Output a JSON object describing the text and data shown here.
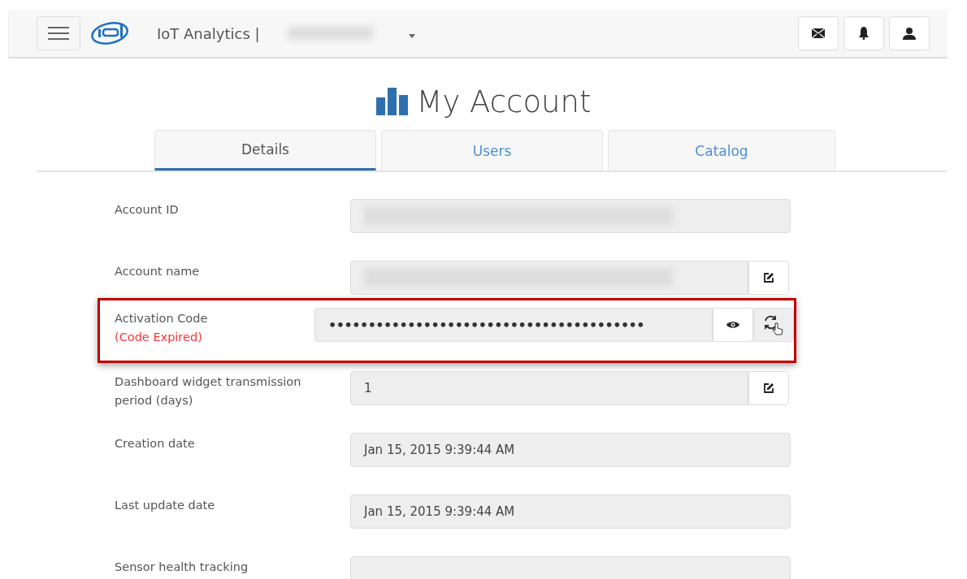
{
  "navbar": {
    "brand": "IoT Analytics |",
    "account_redacted": true
  },
  "page": {
    "title": "My Account"
  },
  "tabs": [
    {
      "label": "Details",
      "selected": true
    },
    {
      "label": "Users",
      "selected": false
    },
    {
      "label": "Catalog",
      "selected": false
    }
  ],
  "fields": [
    {
      "label": "Account ID",
      "kind": "plain",
      "redacted": true,
      "highlighted": false
    },
    {
      "label": "Account name",
      "kind": "edit",
      "redacted": true,
      "highlighted": false
    },
    {
      "label": "Activation Code",
      "note": "(Code Expired)",
      "kind": "secret",
      "value": "••••••••••••••••••••••••••••••••••••••••",
      "highlighted": true
    },
    {
      "label": "Dashboard widget transmission period (days)",
      "kind": "edit",
      "value": "1",
      "highlighted": false
    },
    {
      "label": "Creation date",
      "kind": "plain",
      "value": "Jan 15, 2015 9:39:44 AM",
      "highlighted": false
    },
    {
      "label": "Last update date",
      "kind": "plain",
      "value": "Jan 15, 2015 9:39:44 AM",
      "highlighted": false
    },
    {
      "label": "Sensor health tracking",
      "kind": "plain",
      "highlighted": false
    }
  ]
}
